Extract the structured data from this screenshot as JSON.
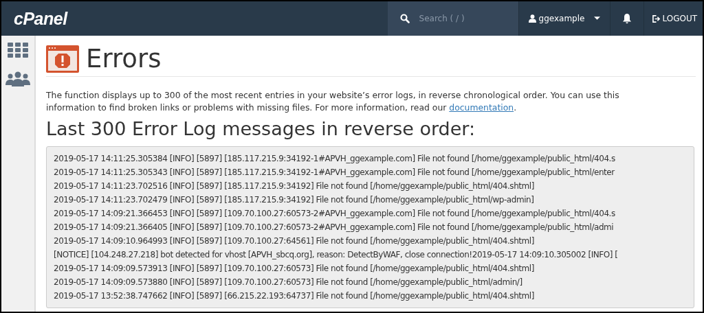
{
  "header": {
    "logo": "cPanel",
    "search": {
      "placeholder": "Search ( / )"
    },
    "user": "ggexample",
    "logout": "LOGOUT"
  },
  "page": {
    "title": "Errors",
    "description": "The function displays up to 300 of the most recent entries in your website’s error logs, in reverse chronological order. You can use this information to find broken links or problems with missing files. For more information, read our ",
    "link": "documentation",
    "description_end": ".",
    "heading": "Last 300 Error Log messages in reverse order:"
  },
  "log_lines": [
    "2019-05-17 14:11:25.305384 [INFO] [5897] [185.117.215.9:34192-1#APVH_ggexample.com] File not found [/home/ggexample/public_html/404.s",
    "2019-05-17 14:11:25.305343 [INFO] [5897] [185.117.215.9:34192-1#APVH_ggexample.com] File not found [/home/ggexample/public_html/enter",
    "2019-05-17 14:11:23.702516 [INFO] [5897] [185.117.215.9:34192] File not found [/home/ggexample/public_html/404.shtml]",
    "2019-05-17 14:11:23.702479 [INFO] [5897] [185.117.215.9:34192] File not found [/home/ggexample/public_html/wp-admin]",
    "2019-05-17 14:09:21.366453 [INFO] [5897] [109.70.100.27:60573-2#APVH_ggexample.com] File not found [/home/ggexample/public_html/404.s",
    "2019-05-17 14:09:21.366405 [INFO] [5897] [109.70.100.27:60573-2#APVH_ggexample.com] File not found [/home/ggexample/public_html/admi",
    "2019-05-17 14:09:10.964993 [INFO] [5897] [109.70.100.27:64561] File not found [/home/ggexample/public_html/404.shtml]",
    "[NOTICE] [104.248.27.218] bot detected for vhost [APVH_sbcq.org], reason: DetectByWAF, close connection!2019-05-17 14:09:10.305002 [INFO] [",
    "2019-05-17 14:09:09.573913 [INFO] [5897] [109.70.100.27:60573] File not found [/home/ggexample/public_html/404.shtml]",
    "2019-05-17 14:09:09.573880 [INFO] [5897] [109.70.100.27:60573] File not found [/home/ggexample/public_html/admin/]",
    "2019-05-17 13:52:38.747662 [INFO] [5897] [66.215.22.193:64737] File not found [/home/ggexample/public_html/404.shtml]"
  ]
}
